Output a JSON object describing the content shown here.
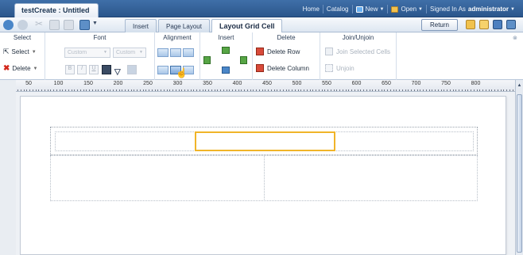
{
  "header": {
    "doc_tab": "testCreate : Untitled",
    "nav": {
      "home": "Home",
      "catalog": "Catalog",
      "new": "New",
      "open": "Open",
      "signed_in_prefix": "Signed In As",
      "user": "administrator"
    }
  },
  "toolbar": {
    "tabs": [
      "Insert",
      "Page Layout",
      "Layout Grid Cell"
    ],
    "active_tab": "Layout Grid Cell",
    "return_label": "Return"
  },
  "ribbon": {
    "groups": {
      "select": "Select",
      "font": "Font",
      "alignment": "Alignment",
      "insert": "Insert",
      "delete": "Delete",
      "join": "Join/Unjoin"
    },
    "select_btn": "Select",
    "delete_btn": "Delete",
    "font_name": "Custom",
    "font_size": "Custom",
    "delete_row": "Delete Row",
    "delete_column": "Delete Column",
    "join_cells": "Join Selected Cells",
    "unjoin": "Unjoin",
    "font_styles": {
      "bold": "B",
      "italic": "I",
      "underline": "U"
    }
  },
  "ruler": {
    "labels": [
      "50",
      "100",
      "150",
      "200",
      "250",
      "300",
      "350",
      "400",
      "450",
      "500",
      "550",
      "600",
      "650",
      "700",
      "750",
      "800"
    ]
  },
  "colors": {
    "header": "#2f5d96",
    "selection": "#f0b429",
    "ribbon_accent": "#7ea3cf"
  }
}
